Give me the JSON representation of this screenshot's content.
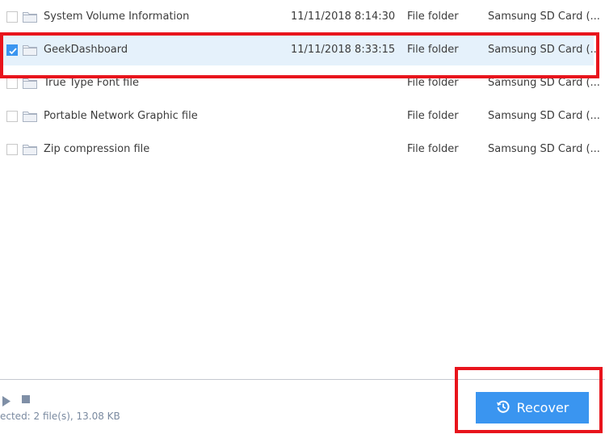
{
  "files": [
    {
      "name": "System Volume Information",
      "date": "11/11/2018 8:14:30",
      "type": "File folder",
      "location": "Samsung SD Card (...",
      "checked": false,
      "selected": false
    },
    {
      "name": "GeekDashboard",
      "date": "11/11/2018 8:33:15",
      "type": "File folder",
      "location": "Samsung SD Card (...",
      "checked": true,
      "selected": true
    },
    {
      "name": "True Type Font file",
      "date": "",
      "type": "File folder",
      "location": "Samsung SD Card (...",
      "checked": false,
      "selected": false
    },
    {
      "name": "Portable Network Graphic file",
      "date": "",
      "type": "File folder",
      "location": "Samsung SD Card (...",
      "checked": false,
      "selected": false
    },
    {
      "name": "Zip compression file",
      "date": "",
      "type": "File folder",
      "location": "Samsung SD Card (...",
      "checked": false,
      "selected": false
    }
  ],
  "footer": {
    "status_text": "ected: 2 file(s), 13.08 KB",
    "recover_label": "Recover"
  },
  "icons": {
    "checkbox": "checkbox-icon",
    "folder": "folder-icon",
    "play": "play-icon",
    "stop": "stop-icon",
    "recover": "history-icon"
  },
  "colors": {
    "accent": "#3a95f0",
    "selected_row": "#e5f1fb",
    "highlight": "#e8141c"
  }
}
